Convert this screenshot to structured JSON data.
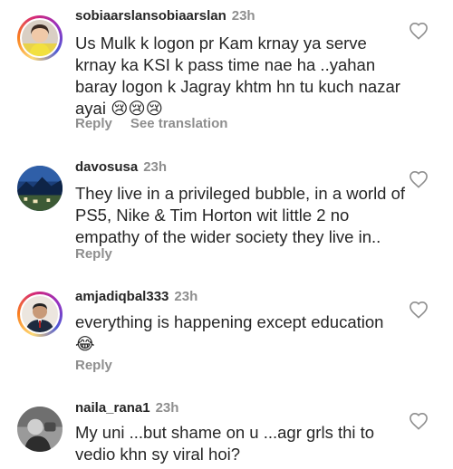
{
  "comments": [
    {
      "username": "sobiaarslansobiaarslan",
      "time": "23h",
      "text": "Us Mulk k logon pr Kam krnay ya serve krnay ka KSI k pass time nae ha ..yahan baray logon k Jagray khtm hn tu kuch nazar ayai 😢😢😢",
      "reply_label": "Reply",
      "translation_label": "See translation"
    },
    {
      "username": "davosusa",
      "time": "23h",
      "text": "They live in a privileged bubble, in a world of PS5, Nike & Tim Horton wit little 2 no empathy of the wider society they live in..",
      "reply_label": "Reply"
    },
    {
      "username": "amjadiqbal333",
      "time": "23h",
      "text": "everything is happening except education 😂",
      "reply_label": "Reply"
    },
    {
      "username": "naila_rana1",
      "time": "23h",
      "text": "My uni ...but shame on u ...agr grls thi to vedio khn sy viral hoi?"
    }
  ],
  "icons": {
    "like": "heart-outline-icon"
  },
  "colors": {
    "text": "#262626",
    "secondary": "#8e8e8e",
    "story_ring": [
      "#feda75",
      "#fa7e1e",
      "#d62976",
      "#962fbf",
      "#4f5bd5"
    ]
  }
}
